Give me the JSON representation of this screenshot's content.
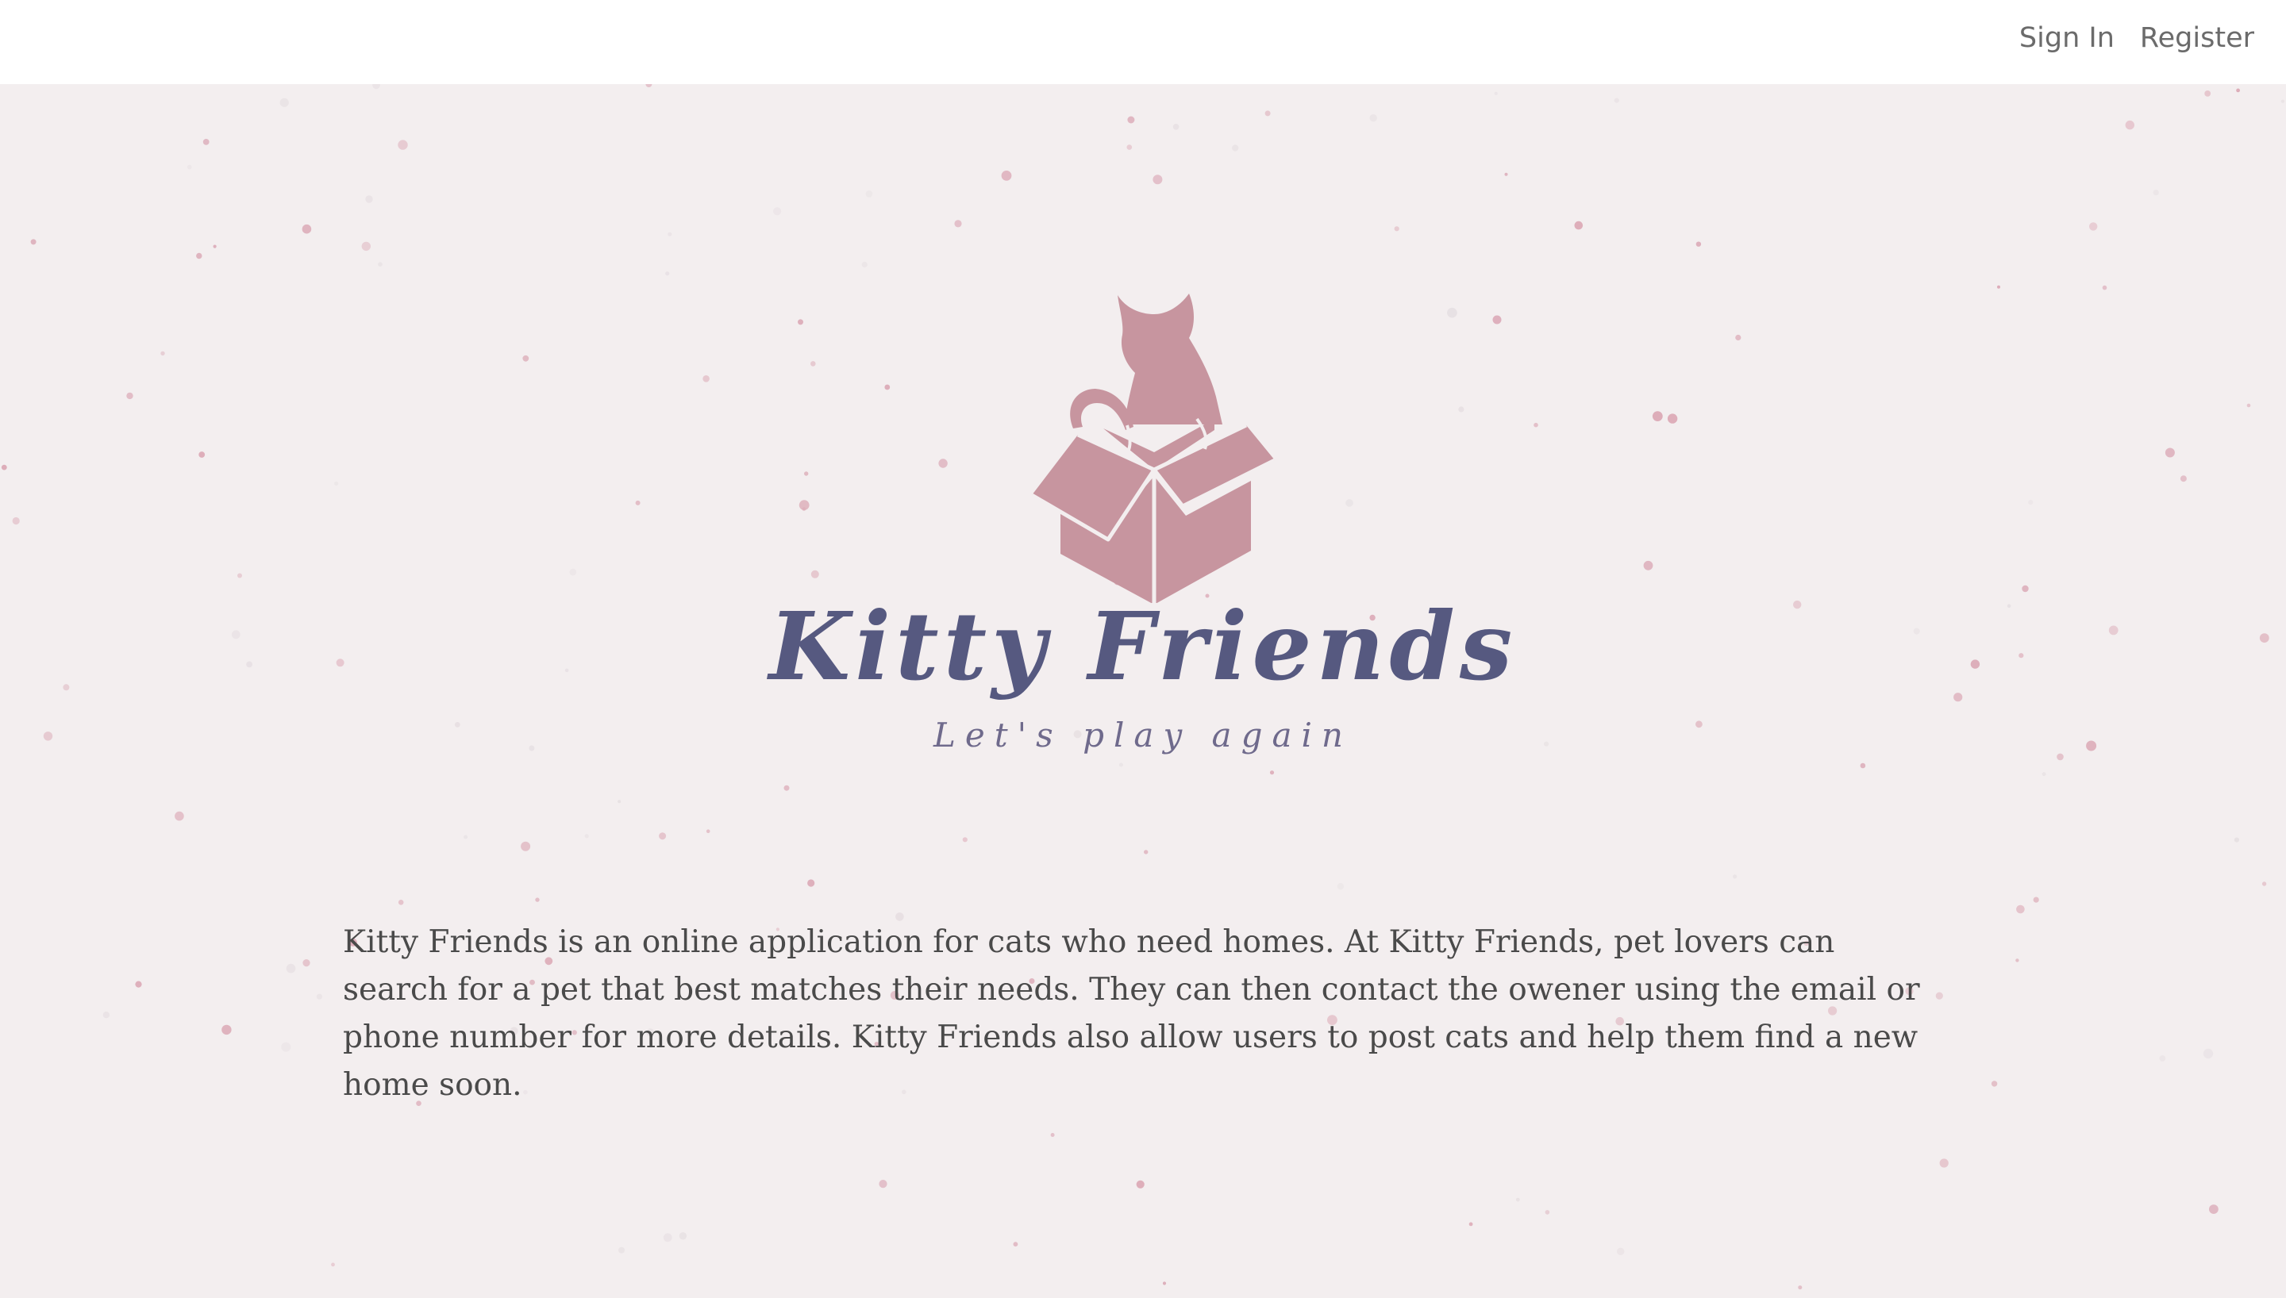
{
  "nav": {
    "sign_in": "Sign In",
    "register": "Register"
  },
  "hero": {
    "title": "Kitty Friends",
    "tagline": "Let's play again",
    "description": "Kitty Friends is an online application for cats who need homes. At Kitty Friends, pet lovers can search for a pet that best matches their needs. They can then contact the owener using the email or phone number for more details. Kitty Friends also allow users to post cats and help them find a new home soon."
  },
  "logo": {
    "icon": "cat-in-box-icon",
    "color": "#c7959f"
  },
  "colors": {
    "background": "#f3eeef",
    "navbar": "#ffffff",
    "title": "#565980",
    "speckle": "#d9a9b6"
  }
}
